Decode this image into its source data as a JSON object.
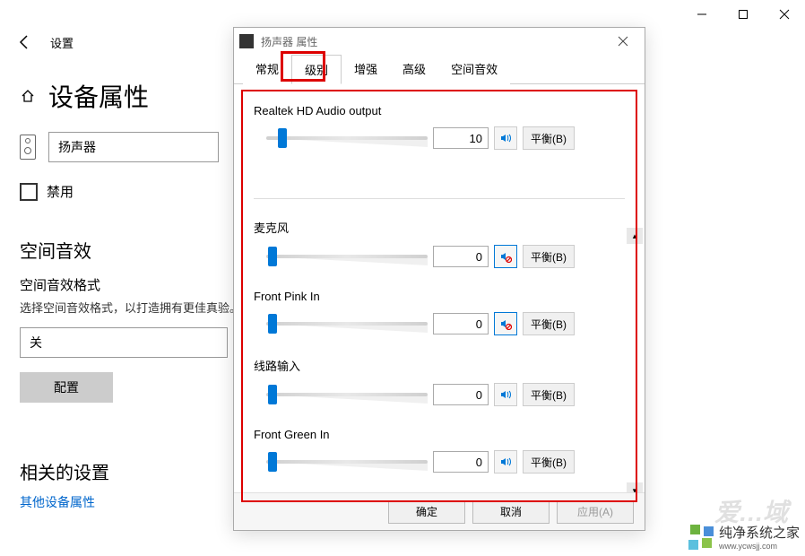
{
  "titlebar": {
    "minimize": "—",
    "maximize": "□",
    "close": "×"
  },
  "settings": {
    "label": "设置",
    "title": "设备属性",
    "device_name": "扬声器",
    "disable": "禁用",
    "spatial_title": "空间音效",
    "spatial_sub": "空间音效格式",
    "spatial_desc": "选择空间音效格式，以打造拥有更佳真验。",
    "spatial_value": "关",
    "config_btn": "配置",
    "related_title": "相关的设置",
    "related_link": "其他设备属性"
  },
  "dialog": {
    "title": "扬声器 属性",
    "tabs": [
      "常规",
      "级别",
      "增强",
      "高级",
      "空间音效"
    ],
    "active_tab": 1,
    "channels": [
      {
        "label": "Realtek HD Audio output",
        "value": "10",
        "pos": 10,
        "muted": false
      },
      {
        "label": "麦克风",
        "value": "0",
        "pos": 4,
        "muted": true
      },
      {
        "label": "Front Pink In",
        "value": "0",
        "pos": 4,
        "muted": true
      },
      {
        "label": "线路输入",
        "value": "0",
        "pos": 4,
        "muted": false
      },
      {
        "label": "Front Green In",
        "value": "0",
        "pos": 4,
        "muted": false
      }
    ],
    "balance_label": "平衡(B)",
    "footer": {
      "ok": "确定",
      "cancel": "取消",
      "apply": "应用(A)"
    }
  },
  "watermark": {
    "text": "纯净系统之家",
    "sub": "www.ycwsjj.com"
  }
}
